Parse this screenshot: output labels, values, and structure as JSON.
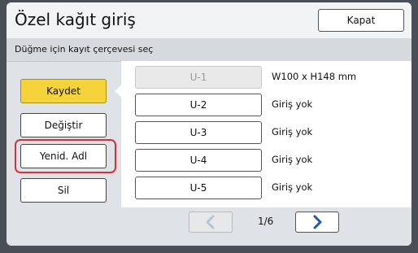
{
  "header": {
    "title": "Özel kağıt giriş",
    "close_label": "Kapat"
  },
  "subtitle": "Düğme için kayıt çerçevesi seç",
  "actions": [
    {
      "label": "Kaydet",
      "active": true
    },
    {
      "label": "Değiştir",
      "active": false
    },
    {
      "label": "Yenid. Adl",
      "active": false,
      "highlighted": true
    },
    {
      "label": "Sil",
      "active": false
    }
  ],
  "slots": [
    {
      "label": "U-1",
      "info": "W100 x H148 mm",
      "disabled": true
    },
    {
      "label": "U-2",
      "info": "Giriş yok",
      "disabled": false
    },
    {
      "label": "U-3",
      "info": "Giriş yok",
      "disabled": false
    },
    {
      "label": "U-4",
      "info": "Giriş yok",
      "disabled": false
    },
    {
      "label": "U-5",
      "info": "Giriş yok",
      "disabled": false
    }
  ],
  "pager": {
    "page_text": "1/6",
    "prev_icon": "chevron-left-icon",
    "next_icon": "chevron-right-icon",
    "prev_disabled": true
  },
  "colors": {
    "active_button": "#f4d33b",
    "highlight_outline": "#d4323a",
    "arrow_blue": "#1f5aa6",
    "arrow_disabled": "#b7c3d2"
  }
}
